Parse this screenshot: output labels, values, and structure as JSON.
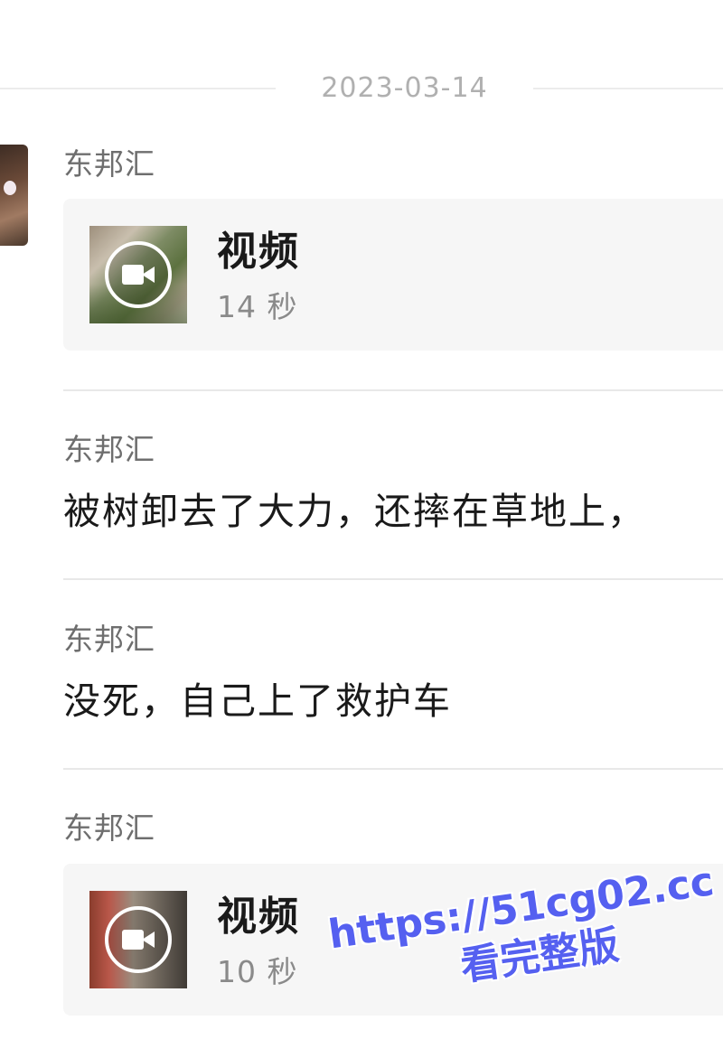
{
  "date_separator": "2023-03-14",
  "messages": [
    {
      "sender": "东邦汇",
      "type": "video",
      "video_title": "视频",
      "duration": "14 秒"
    },
    {
      "sender": "东邦汇",
      "type": "text",
      "text": "被树卸去了大力，还摔在草地上，"
    },
    {
      "sender": "东邦汇",
      "type": "text",
      "text": "没死，自己上了救护车"
    },
    {
      "sender": "东邦汇",
      "type": "video",
      "video_title": "视频",
      "duration": "10 秒"
    }
  ],
  "watermark": {
    "url": "https://51cg02.cc",
    "subtitle": "看完整版",
    "color": "#5560f0"
  },
  "icons": {
    "play": "video-camera-icon"
  }
}
